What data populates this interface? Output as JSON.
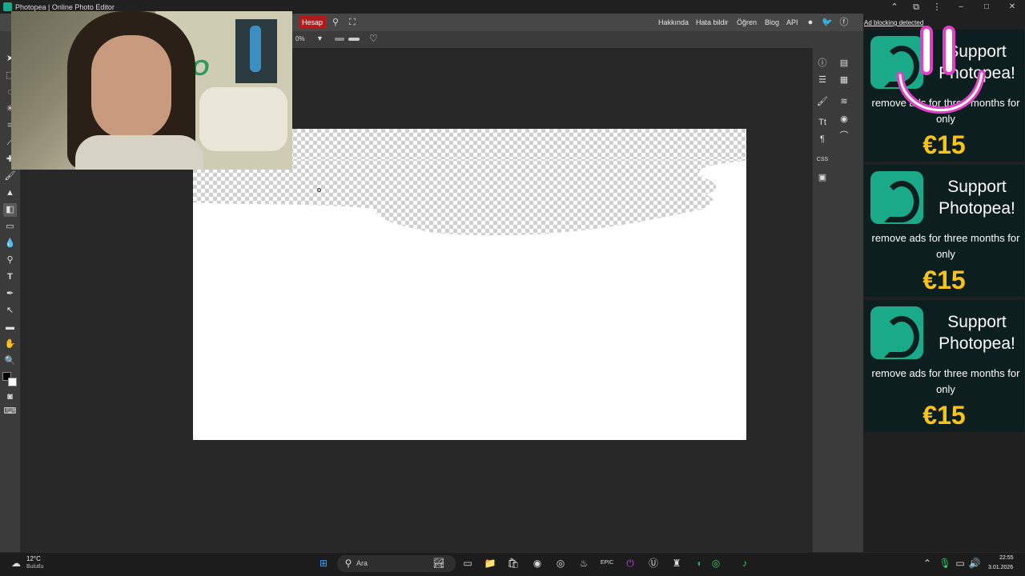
{
  "browser": {
    "title": "Photopea | Online Photo Editor",
    "controls": [
      "–",
      "□",
      "✕"
    ]
  },
  "menubar": {
    "account_label": "Hesap",
    "links": [
      "Hakkında",
      "Hata bildir",
      "Öğren",
      "Blog",
      "API"
    ]
  },
  "options": {
    "opacity_value": "0%"
  },
  "ads": {
    "notice": "Ad blocking detected",
    "items": [
      {
        "title": "Support Photopea!",
        "text": "remove ads for three months for only",
        "price": "€15"
      },
      {
        "title": "Support Photopea!",
        "text": "remove ads for three months for only",
        "price": "€15"
      },
      {
        "title": "Support Photopea!",
        "text": "remove ads for three months for only",
        "price": "€15"
      }
    ]
  },
  "right_panel": {
    "css_label": "CSS"
  },
  "taskbar": {
    "weather_temp": "12°C",
    "weather_desc": "Bulutlu",
    "search_placeholder": "Ara",
    "time": "22:55",
    "date": "3.01.2026"
  },
  "colors": {
    "accent_red": "#b51a1a",
    "photopea_teal": "#1aaa8a",
    "price_yellow": "#f7c31a"
  }
}
